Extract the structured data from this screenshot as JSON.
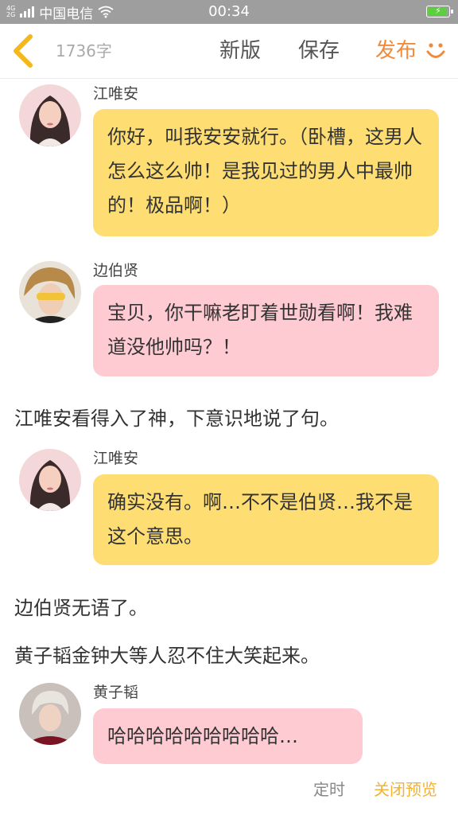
{
  "status_bar": {
    "network_top": "4G",
    "network_bottom": "2G",
    "carrier": "中国电信",
    "time": "00:34"
  },
  "toolbar": {
    "word_count": "1736字",
    "new_version": "新版",
    "save": "保存",
    "publish": "发布"
  },
  "messages": [
    {
      "speaker": "江唯安",
      "text": "你好，叫我安安就行。（卧槽，这男人怎么这么帅！是我见过的男人中最帅的！极品啊！）",
      "color": "#fede73"
    },
    {
      "speaker": "边伯贤",
      "text": "宝贝，你干嘛老盯着世勋看啊！我难道没他帅吗？！",
      "color": "#fecbd3"
    },
    {
      "narration": "江唯安看得入了神，下意识地说了句。"
    },
    {
      "speaker": "江唯安",
      "text": "确实没有。啊…不不是伯贤…我不是这个意思。",
      "color": "#fede73"
    },
    {
      "narration": "边伯贤无语了。"
    },
    {
      "narration": "黄子韬金钟大等人忍不住大笑起来。"
    },
    {
      "speaker": "黄子韬",
      "text": "哈哈哈哈哈哈哈哈哈…",
      "color": "#fecbd3"
    }
  ],
  "footer": {
    "timer": "定时",
    "close_preview": "关闭预览"
  },
  "colors": {
    "accent_orange": "#f28a3c",
    "footer_accent": "#f2b233",
    "status_bar": "#9e9e9e"
  }
}
